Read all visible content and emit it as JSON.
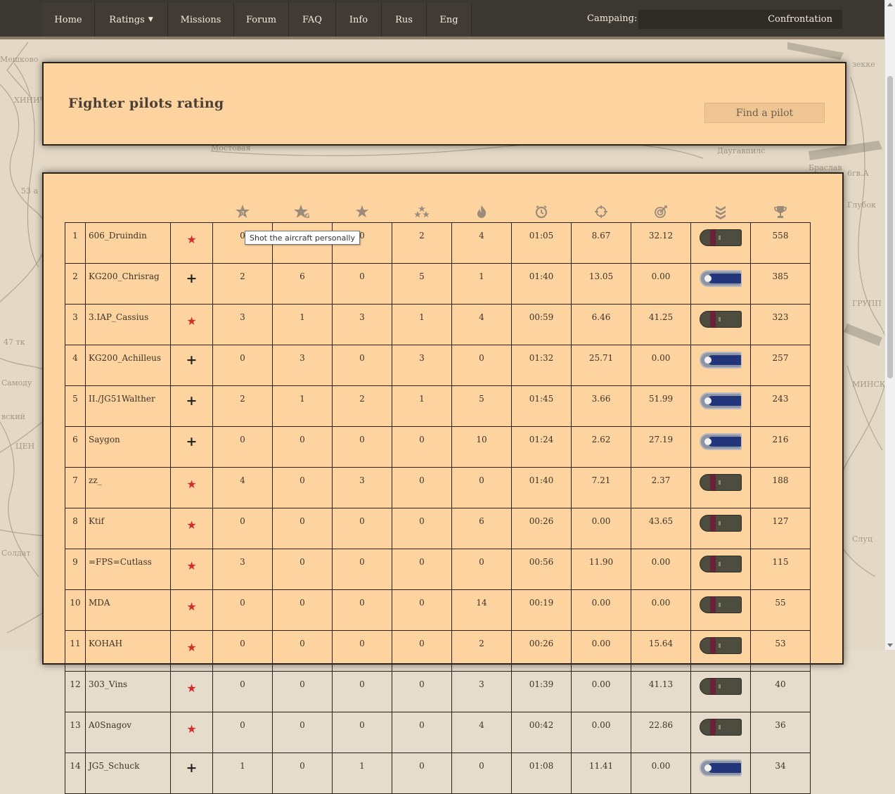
{
  "nav": {
    "items": [
      "Home",
      "Ratings",
      "Missions",
      "Forum",
      "FAQ",
      "Info",
      "Rus",
      "Eng"
    ],
    "campaign_label": "Campaing:",
    "campaign_value": "Confrontation"
  },
  "page": {
    "title": "Fighter pilots rating",
    "find_button": "Find a pilot"
  },
  "tooltip": "Shot the aircraft personally",
  "table": {
    "column_icons": [
      "personal-kills-icon",
      "group-kills-icon",
      "star-icon",
      "triple-star-icon",
      "fire-icon",
      "clock-icon",
      "crosshair-icon",
      "target-icon",
      "rank-chevron-icon",
      "trophy-icon"
    ],
    "rows": [
      {
        "n": "1",
        "name": "606_Druindin",
        "side": "soviet",
        "c1": "0",
        "c2": "",
        "c3": "0",
        "c4": "2",
        "c5": "4",
        "time": "01:05",
        "r1": "8.67",
        "r2": "32.12",
        "score": "558"
      },
      {
        "n": "2",
        "name": "KG200_Chrisrag",
        "side": "luft",
        "c1": "2",
        "c2": "6",
        "c3": "0",
        "c4": "5",
        "c5": "1",
        "time": "01:40",
        "r1": "13.05",
        "r2": "0.00",
        "score": "385"
      },
      {
        "n": "3",
        "name": "3.IAP_Cassius",
        "side": "soviet",
        "c1": "3",
        "c2": "1",
        "c3": "3",
        "c4": "1",
        "c5": "4",
        "time": "00:59",
        "r1": "6.46",
        "r2": "41.25",
        "score": "323"
      },
      {
        "n": "4",
        "name": "KG200_Achilleus",
        "side": "luft",
        "c1": "0",
        "c2": "3",
        "c3": "0",
        "c4": "3",
        "c5": "0",
        "time": "01:32",
        "r1": "25.71",
        "r2": "0.00",
        "score": "257"
      },
      {
        "n": "5",
        "name": "II./JG51Walther",
        "side": "luft",
        "c1": "2",
        "c2": "1",
        "c3": "2",
        "c4": "1",
        "c5": "5",
        "time": "01:45",
        "r1": "3.66",
        "r2": "51.99",
        "score": "243"
      },
      {
        "n": "6",
        "name": "Saygon",
        "side": "luft",
        "c1": "0",
        "c2": "0",
        "c3": "0",
        "c4": "0",
        "c5": "10",
        "time": "01:24",
        "r1": "2.62",
        "r2": "27.19",
        "score": "216"
      },
      {
        "n": "7",
        "name": "zz_",
        "side": "soviet",
        "c1": "4",
        "c2": "0",
        "c3": "3",
        "c4": "0",
        "c5": "0",
        "time": "01:40",
        "r1": "7.21",
        "r2": "2.37",
        "score": "188"
      },
      {
        "n": "8",
        "name": "Ktif",
        "side": "soviet",
        "c1": "0",
        "c2": "0",
        "c3": "0",
        "c4": "0",
        "c5": "6",
        "time": "00:26",
        "r1": "0.00",
        "r2": "43.65",
        "score": "127"
      },
      {
        "n": "9",
        "name": "=FPS=Cutlass",
        "side": "soviet",
        "c1": "3",
        "c2": "0",
        "c3": "0",
        "c4": "0",
        "c5": "0",
        "time": "00:56",
        "r1": "11.90",
        "r2": "0.00",
        "score": "115"
      },
      {
        "n": "10",
        "name": "MDA",
        "side": "soviet",
        "c1": "0",
        "c2": "0",
        "c3": "0",
        "c4": "0",
        "c5": "14",
        "time": "00:19",
        "r1": "0.00",
        "r2": "0.00",
        "score": "55"
      },
      {
        "n": "11",
        "name": "KOHAH",
        "side": "soviet",
        "c1": "0",
        "c2": "0",
        "c3": "0",
        "c4": "0",
        "c5": "2",
        "time": "00:26",
        "r1": "0.00",
        "r2": "15.64",
        "score": "53"
      },
      {
        "n": "12",
        "name": "303_Vins",
        "side": "soviet",
        "c1": "0",
        "c2": "0",
        "c3": "0",
        "c4": "0",
        "c5": "3",
        "time": "01:39",
        "r1": "0.00",
        "r2": "41.13",
        "score": "40"
      },
      {
        "n": "13",
        "name": "A0Snagov",
        "side": "soviet",
        "c1": "0",
        "c2": "0",
        "c3": "0",
        "c4": "0",
        "c5": "4",
        "time": "00:42",
        "r1": "0.00",
        "r2": "22.86",
        "score": "36"
      },
      {
        "n": "14",
        "name": "JG5_Schuck",
        "side": "luft",
        "c1": "1",
        "c2": "0",
        "c3": "1",
        "c4": "0",
        "c5": "0",
        "time": "01:08",
        "r1": "11.41",
        "r2": "0.00",
        "score": "34"
      }
    ]
  }
}
